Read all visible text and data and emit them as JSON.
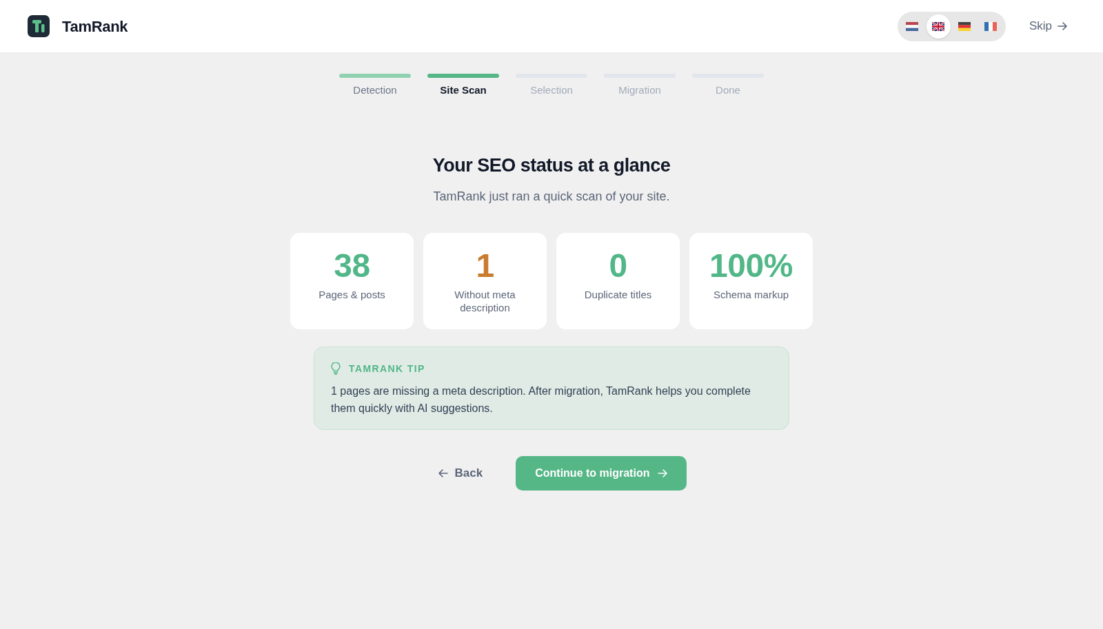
{
  "header": {
    "brand": "TamRank",
    "languages": [
      {
        "kind": "netherlands",
        "selected": false
      },
      {
        "kind": "uk",
        "selected": true
      },
      {
        "kind": "germany",
        "selected": false
      },
      {
        "kind": "france",
        "selected": false
      }
    ],
    "skip": "Skip"
  },
  "steps": [
    {
      "label": "Detection",
      "completed": true,
      "selected": false
    },
    {
      "label": "Site Scan",
      "completed": false,
      "selected": true
    },
    {
      "label": "Selection",
      "completed": false,
      "selected": false
    },
    {
      "label": "Migration",
      "completed": false,
      "selected": false
    },
    {
      "label": "Done",
      "completed": false,
      "selected": false
    }
  ],
  "heading": "Your SEO status at a glance",
  "subtitle": "TamRank just ran a quick scan of your site.",
  "stats": [
    {
      "value": "38",
      "label": "Pages & posts",
      "color": "#52b788"
    },
    {
      "value": "1",
      "label": "Without meta description",
      "color": "#c97b2e"
    },
    {
      "value": "0",
      "label": "Duplicate titles",
      "color": "#52b788"
    },
    {
      "value": "100%",
      "label": "Schema markup",
      "color": "#52b788"
    }
  ],
  "tip": {
    "title": "TAMRANK TIP",
    "text": "1 pages are missing a meta description. After migration, TamRank helps you complete them quickly with AI suggestions."
  },
  "actions": {
    "back": "Back",
    "continue": "Continue to migration"
  }
}
